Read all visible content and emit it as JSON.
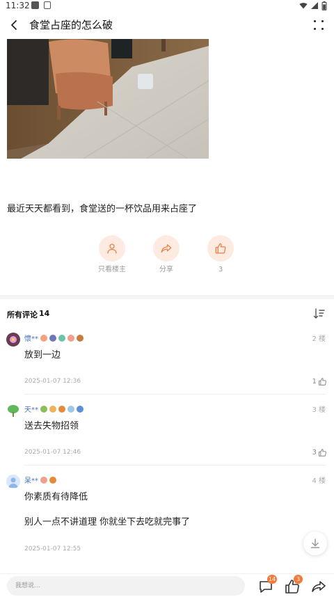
{
  "status_bar": {
    "time": "11:32"
  },
  "header": {
    "title": "食堂占座的怎么破"
  },
  "post": {
    "text": "最近天天都看到，食堂送的一杯饮品用来占座了",
    "actions": [
      {
        "label": "只看楼主",
        "icon": "person-icon"
      },
      {
        "label": "分享",
        "icon": "share-icon"
      },
      {
        "label": "3",
        "icon": "thumbs-up-icon"
      }
    ]
  },
  "comments": {
    "title": "所有评论",
    "count": "14",
    "items": [
      {
        "username": "懷**",
        "floor": "2 楼",
        "body": "放到一边",
        "body2": "",
        "time": "2025-01-07 12:36",
        "likes": "1"
      },
      {
        "username": "天**",
        "floor": "3 楼",
        "body": "送去失物招领",
        "body2": "",
        "time": "2025-01-07 12:46",
        "likes": "3"
      },
      {
        "username": "呆**",
        "floor": "4 楼",
        "body": "你素质有待降低",
        "body2": "别人一点不讲道理 你就坐下去吃就完事了",
        "time": "2025-01-07 12:55",
        "likes": ""
      }
    ]
  },
  "bottom_bar": {
    "placeholder": "我想说...",
    "comment_count": "14",
    "like_count": "3"
  },
  "colors": {
    "accent": "#f27a3a",
    "accent_light": "#fdebe1",
    "username": "#4a76b8"
  }
}
